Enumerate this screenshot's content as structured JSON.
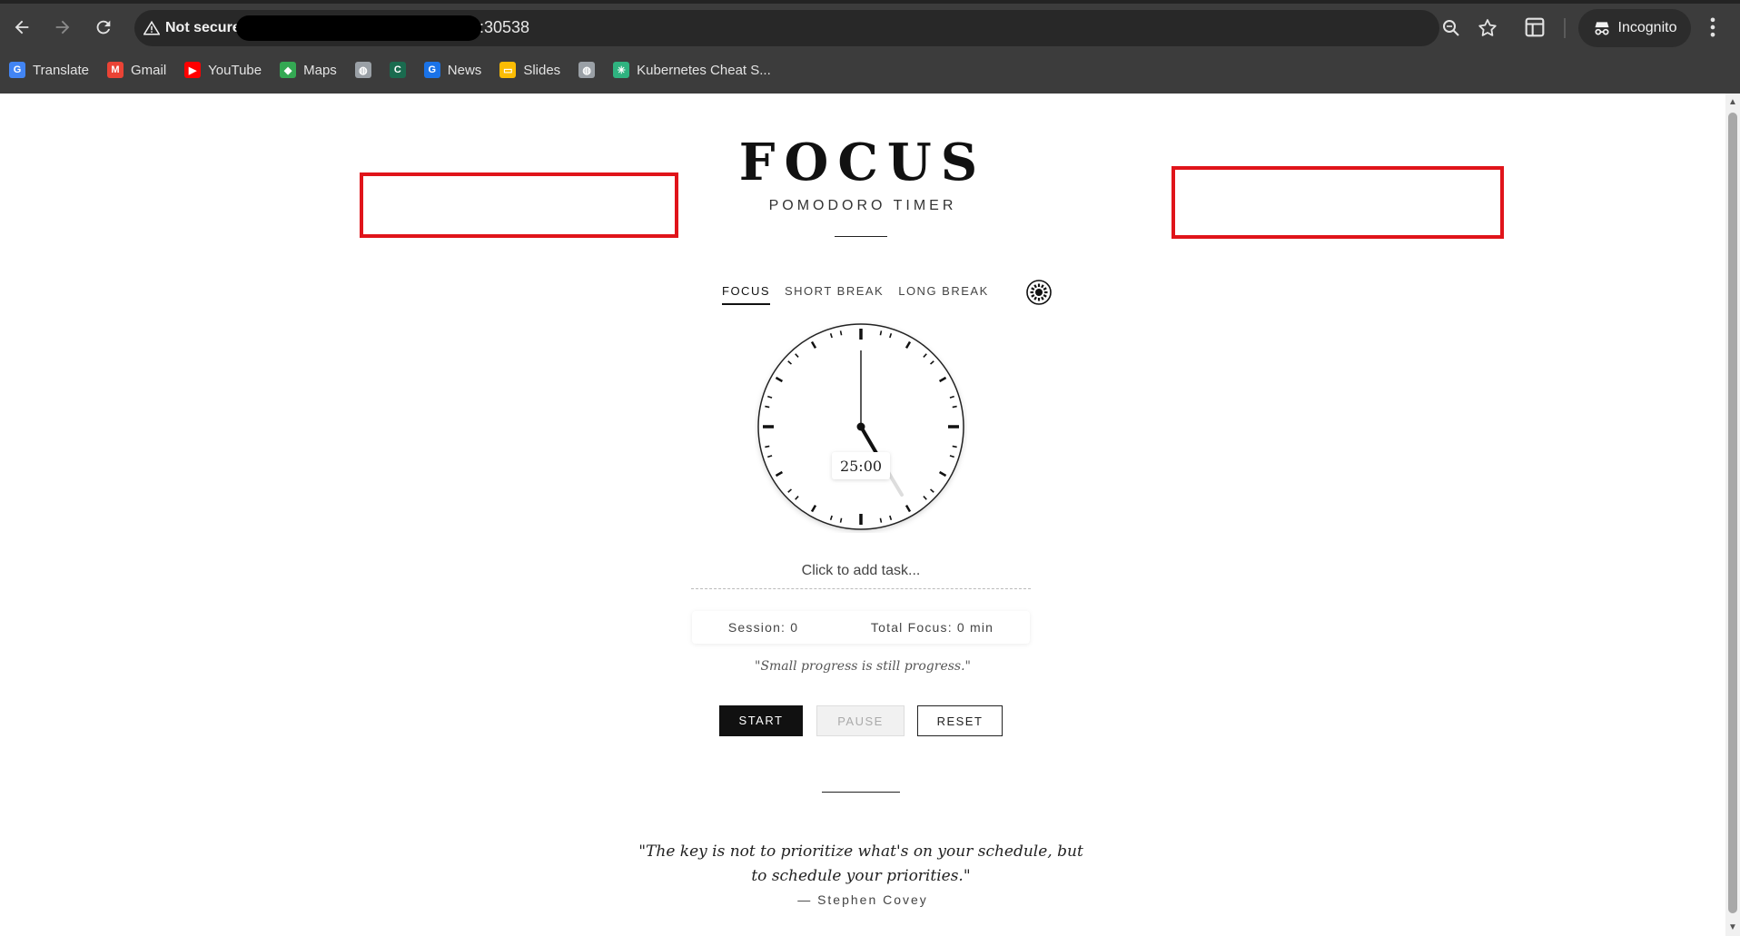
{
  "browser": {
    "security_label": "Not secure",
    "url_port": ":30538",
    "incognito_label": "Incognito",
    "bookmarks": [
      {
        "label": "Translate",
        "icon": "translate-icon",
        "color": "#4285f4"
      },
      {
        "label": "Gmail",
        "icon": "gmail-icon",
        "color": "#ea4335"
      },
      {
        "label": "YouTube",
        "icon": "youtube-icon",
        "color": "#ff0000"
      },
      {
        "label": "Maps",
        "icon": "maps-icon",
        "color": "#34a853"
      },
      {
        "label": "",
        "icon": "globe-icon",
        "color": "#9aa0a6"
      },
      {
        "label": "",
        "icon": "c-logo-icon",
        "color": "#1a6b4f"
      },
      {
        "label": "News",
        "icon": "google-news-icon",
        "color": "#1a73e8"
      },
      {
        "label": "Slides",
        "icon": "slides-icon",
        "color": "#fbbc04"
      },
      {
        "label": "",
        "icon": "globe-icon",
        "color": "#9aa0a6"
      },
      {
        "label": "Kubernetes Cheat S...",
        "icon": "kubernetes-icon",
        "color": "#2fb380"
      }
    ]
  },
  "header": {
    "title": "FOCUS",
    "subtitle": "POMODORO TIMER"
  },
  "tabs": [
    {
      "label": "FOCUS",
      "active": true
    },
    {
      "label": "SHORT BREAK",
      "active": false
    },
    {
      "label": "LONG BREAK",
      "active": false
    }
  ],
  "timer": {
    "display": "25:00"
  },
  "task": {
    "placeholder": "Click to add task..."
  },
  "stats": {
    "session": "Session: 0",
    "total_focus": "Total Focus: 0 min"
  },
  "mini_quote": "\"Small progress is still progress.\"",
  "controls": {
    "start": "START",
    "pause": "PAUSE",
    "reset": "RESET"
  },
  "quote": {
    "text": "\"The key is not to prioritize what's on your schedule, but to schedule your priorities.\"",
    "author": "— Stephen Covey"
  },
  "colors": {
    "accent": "#111111",
    "highlight": "#e0141a"
  }
}
